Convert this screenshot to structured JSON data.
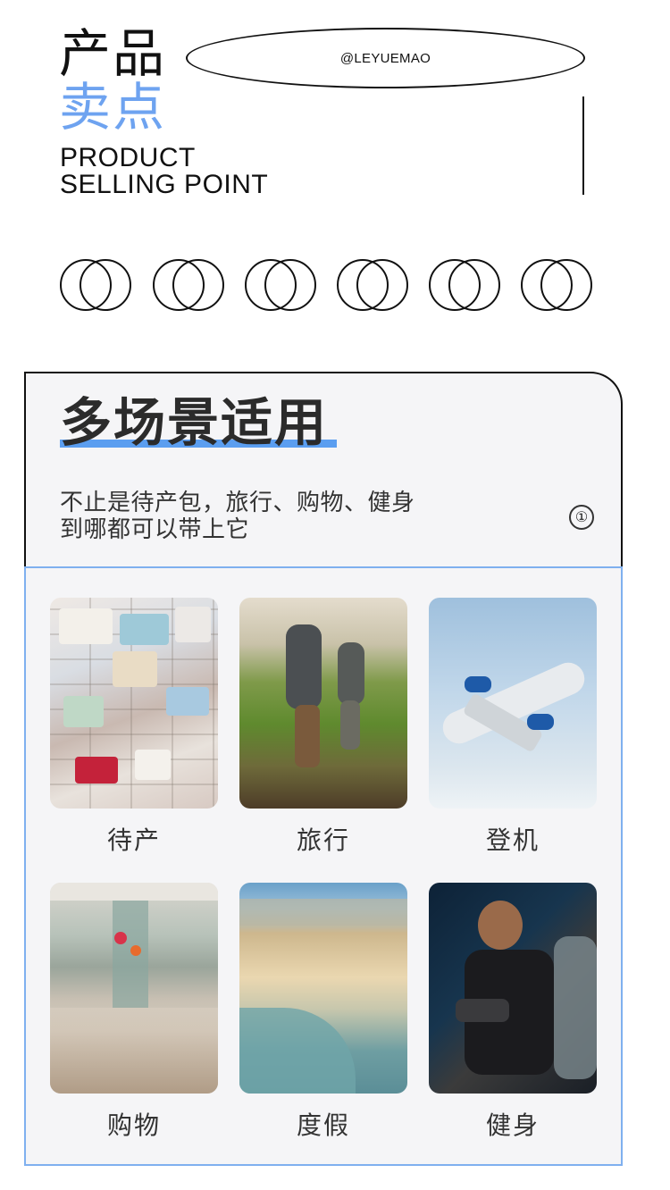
{
  "header": {
    "title_line1": "产品",
    "title_line2": "卖点",
    "title_en_line1": "PRODUCT",
    "title_en_line2": "SELLING POINT",
    "brand_handle": "@LEYUEMAO"
  },
  "section": {
    "title": "多场景适用",
    "desc_line1": "不止是待产包，旅行、购物、健身",
    "desc_line2": "到哪都可以带上它",
    "badge": "①"
  },
  "scenes": [
    {
      "label": "待产",
      "image": "baby-clothes-photo"
    },
    {
      "label": "旅行",
      "image": "hikers-photo"
    },
    {
      "label": "登机",
      "image": "airplane-photo"
    },
    {
      "label": "购物",
      "image": "shopping-mall-photo"
    },
    {
      "label": "度假",
      "image": "beach-photo"
    },
    {
      "label": "健身",
      "image": "fitness-photo"
    }
  ],
  "colors": {
    "accent": "#6ea3f0",
    "title_bar": "#5b9ef0",
    "card_border": "#7fb0ef",
    "card_bg": "#f5f5f7"
  }
}
